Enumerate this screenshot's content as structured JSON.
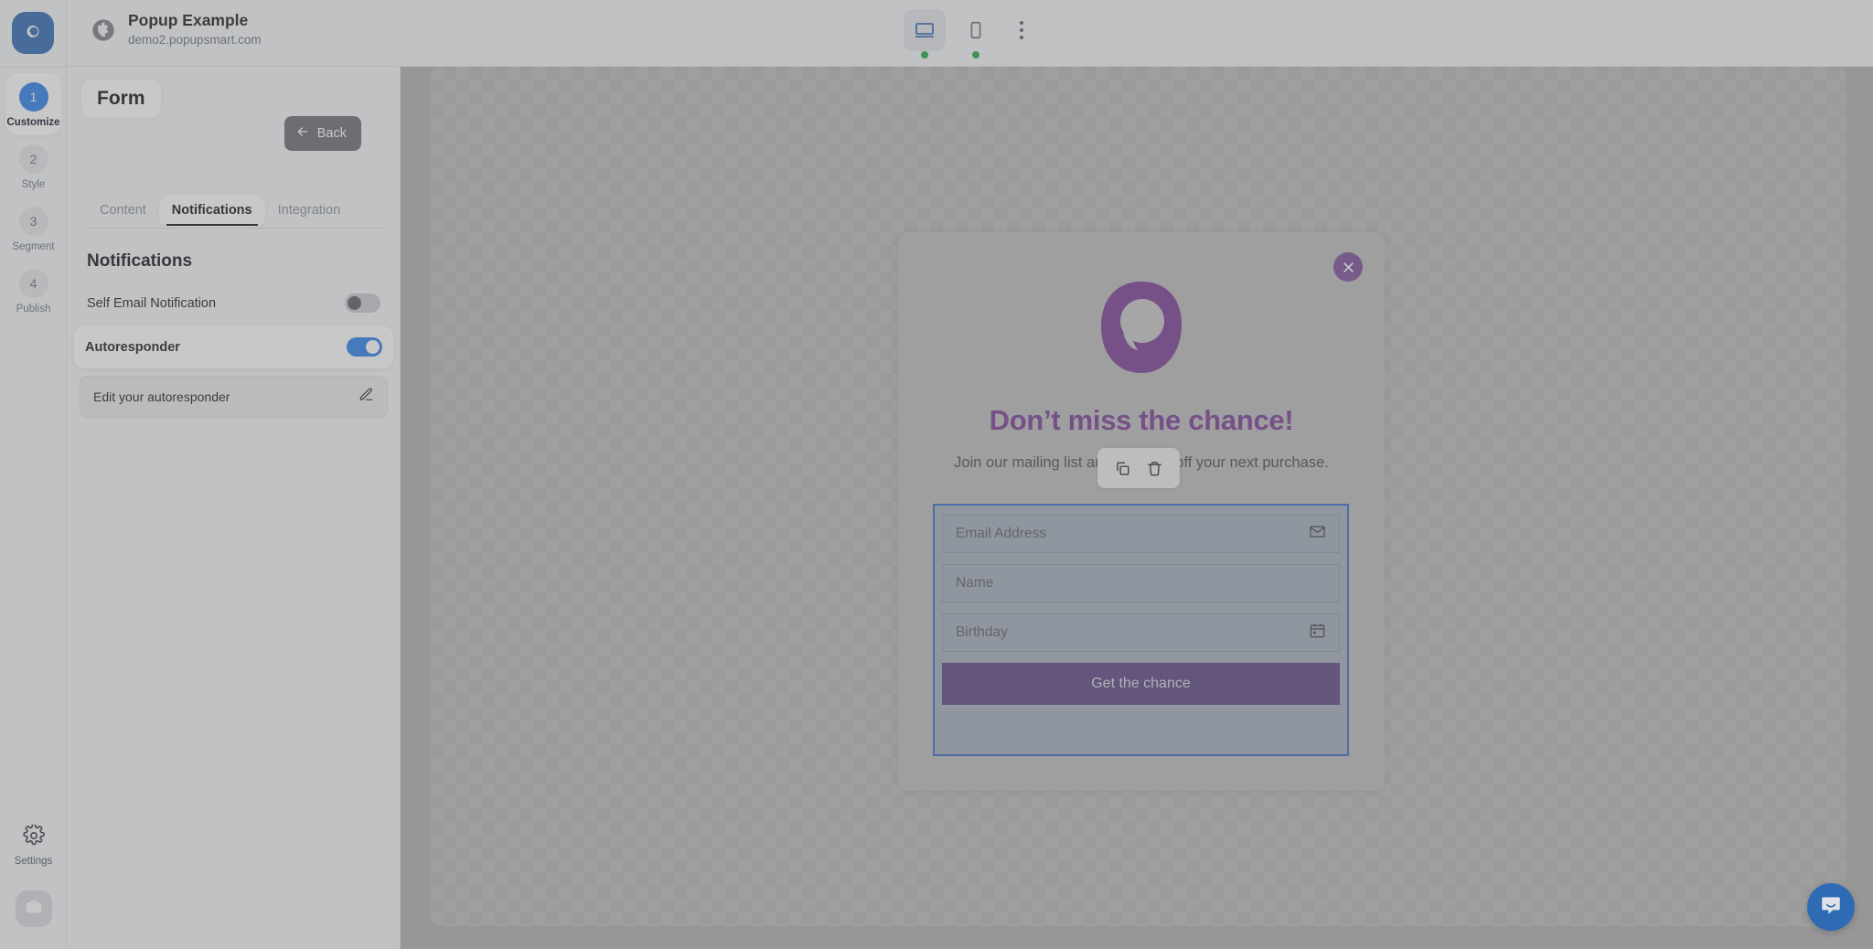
{
  "app": {
    "logo_icon": "popupsmart-logo-icon"
  },
  "header": {
    "globe_icon": "globe-icon",
    "site_title": "Popup Example",
    "site_url": "demo2.popupsmart.com",
    "devices": [
      {
        "name": "desktop",
        "icon": "desktop-icon",
        "active": true,
        "status": "online"
      },
      {
        "name": "mobile",
        "icon": "mobile-icon",
        "active": false,
        "status": "online"
      }
    ],
    "more_icon": "kebab-menu-icon"
  },
  "rail": {
    "steps": [
      {
        "number": "1",
        "label": "Customize",
        "active": true
      },
      {
        "number": "2",
        "label": "Style",
        "active": false
      },
      {
        "number": "3",
        "label": "Segment",
        "active": false
      },
      {
        "number": "4",
        "label": "Publish",
        "active": false
      }
    ],
    "settings_label": "Settings",
    "settings_icon": "gear-icon",
    "briefcase_icon": "briefcase-icon"
  },
  "panel": {
    "title": "Form",
    "back_label": "Back",
    "back_icon": "arrow-left-icon",
    "tabs": [
      {
        "label": "Content",
        "active": false
      },
      {
        "label": "Notifications",
        "active": true
      },
      {
        "label": "Integration",
        "active": false
      }
    ],
    "section_title": "Notifications",
    "options": [
      {
        "label": "Self Email Notification",
        "toggle": "off"
      },
      {
        "label": "Autoresponder",
        "toggle": "on"
      }
    ],
    "sub_row": {
      "label": "Edit your autoresponder",
      "icon": "pencil-edit-icon"
    }
  },
  "popup": {
    "close_icon": "close-icon",
    "logo_icon": "popupsmart-p-logo-icon",
    "heading": "Don’t miss the chance!",
    "subtext": "Join our mailing list and get 15% off your next purchase.",
    "fields": [
      {
        "placeholder": "Email Address",
        "icon": "envelope-icon"
      },
      {
        "placeholder": "Name",
        "icon": ""
      },
      {
        "placeholder": "Birthday",
        "icon": "calendar-icon"
      }
    ],
    "cta_label": "Get the chance",
    "block_toolbar": [
      {
        "name": "duplicate",
        "icon": "copy-icon"
      },
      {
        "name": "delete",
        "icon": "trash-icon"
      }
    ]
  },
  "colors": {
    "accent_blue": "#2f80ed",
    "brand_purple": "#7b3f98",
    "cta_purple": "#5d4683",
    "selection_blue": "#3a6fc4",
    "status_green": "#22a745"
  },
  "intercom": {
    "icon": "chat-bubble-icon"
  }
}
